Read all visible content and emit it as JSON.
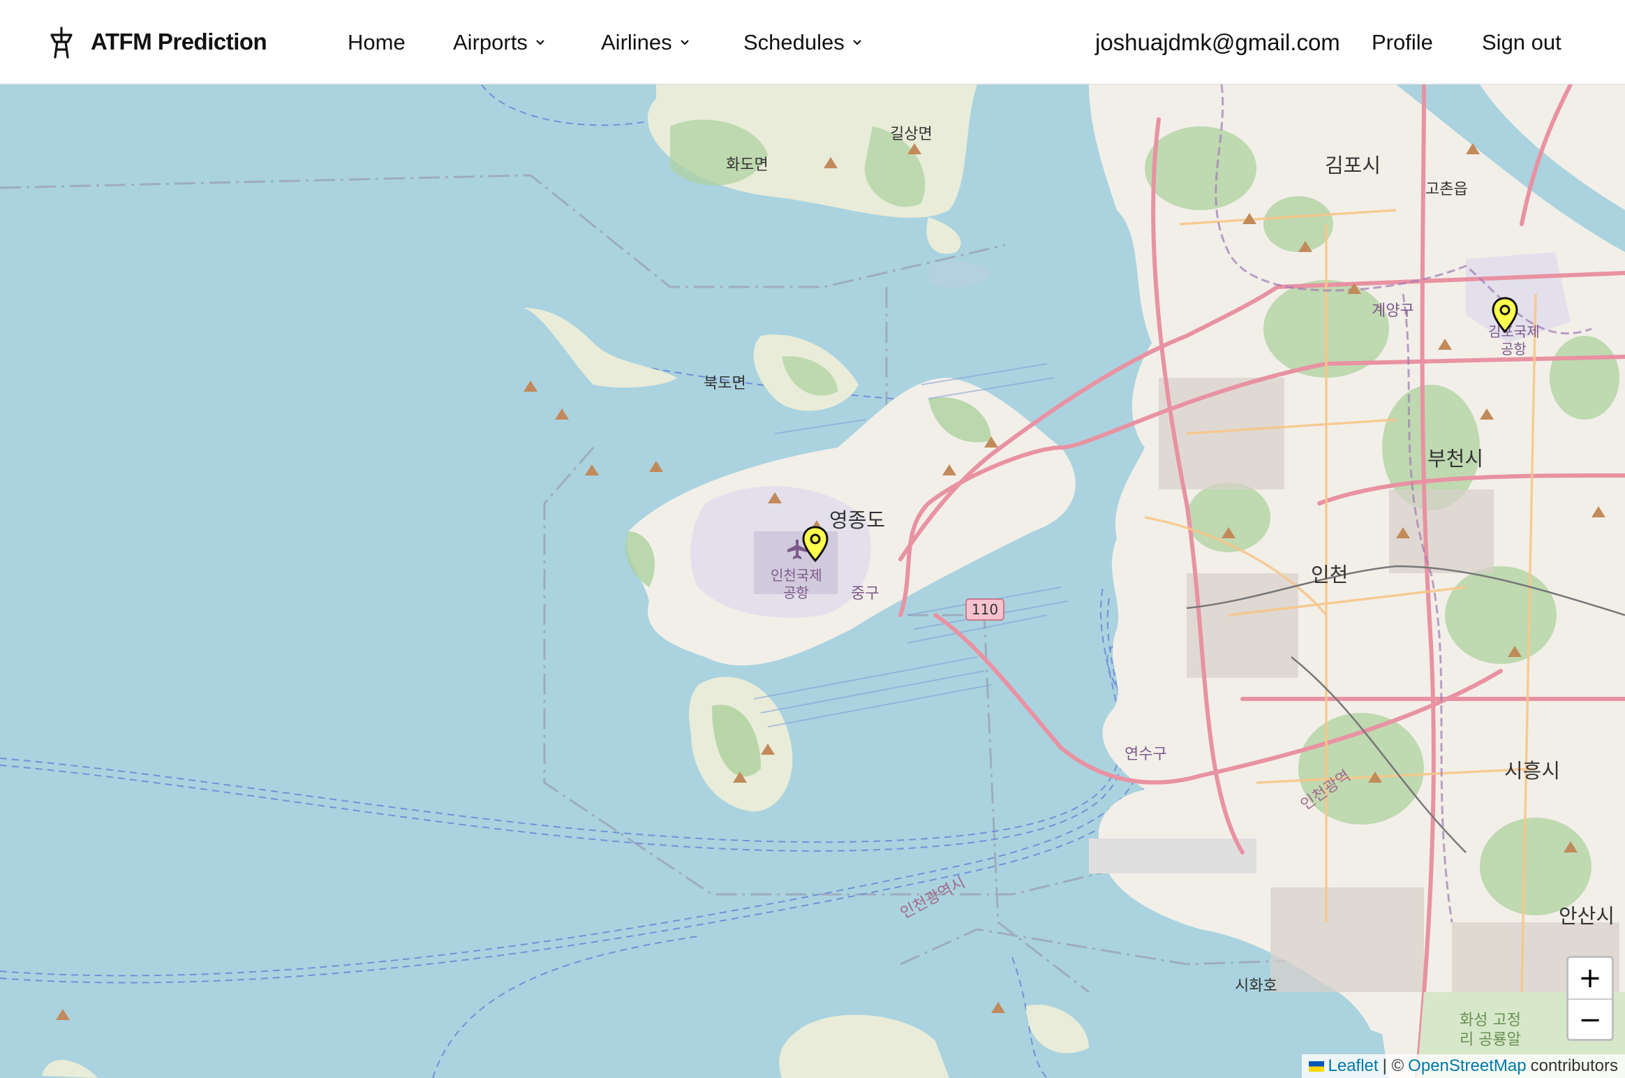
{
  "header": {
    "brand_title": "ATFM Prediction",
    "brand_icon": "control-tower-icon",
    "nav": {
      "home": "Home",
      "airports": "Airports",
      "airlines": "Airlines",
      "schedules": "Schedules"
    },
    "user_email": "joshuajdmk@gmail.com",
    "profile": "Profile",
    "sign_out": "Sign out"
  },
  "map": {
    "markers": [
      {
        "name": "인천국제공항",
        "color": "#ffff4d"
      },
      {
        "name": "김포국제공항",
        "color": "#ffff4d"
      }
    ],
    "labels": {
      "hwado": "화도면",
      "gilsang": "길상면",
      "gimpo": "김포시",
      "gochon": "고촌읍",
      "bukdo": "북도면",
      "gyeyang": "계양구",
      "gimpo_airport_1": "김포국제",
      "gimpo_airport_2": "공항",
      "bucheon": "부천시",
      "yeongjongdo": "영종도",
      "incheon_airport_1": "인천국제",
      "incheon_airport_2": "공항",
      "junggu": "중구",
      "incheon": "인천",
      "yeonsu": "연수구",
      "incheon_metro_1": "인천광역시",
      "incheon_metro_2": "인천광역",
      "siheung": "시흥시",
      "ansan": "안산시",
      "sihwaho": "시화호",
      "hwaseong_1": "화성 고정",
      "hwaseong_2": "리 공룡알",
      "route_110": "110"
    },
    "zoom_in": "+",
    "zoom_out": "−",
    "attribution": {
      "leaflet": "Leaflet",
      "sep": "| ©",
      "osm": "OpenStreetMap",
      "contributors": "contributors"
    },
    "colors": {
      "water": "#aad3df",
      "land": "#f2efe9",
      "forest": "#add19e",
      "road_major": "#e892a2",
      "road_secondary": "#f7c78b",
      "marker_fill": "#ffff4d",
      "link": "#0078a8"
    }
  }
}
